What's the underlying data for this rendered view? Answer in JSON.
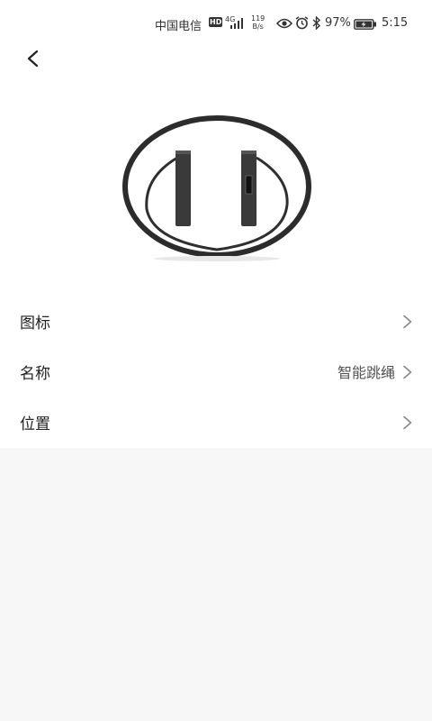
{
  "status_bar": {
    "carrier": "中国电信",
    "hd": "HD",
    "network": "4G",
    "speed_value": "119",
    "speed_unit": "B/s",
    "battery": "97%",
    "time": "5:15"
  },
  "header": {
    "back_icon": "chevron-left-icon"
  },
  "product_image": {
    "icon": "jump-rope-image"
  },
  "settings": [
    {
      "label": "图标",
      "value": "",
      "icon": "chevron-right-icon"
    },
    {
      "label": "名称",
      "value": "智能跳绳",
      "icon": "chevron-right-icon"
    },
    {
      "label": "位置",
      "value": "",
      "icon": "chevron-right-icon"
    }
  ],
  "colors": {
    "surface": "#ffffff",
    "background": "#f7f7f7",
    "text": "#222222",
    "secondary_text": "#555555"
  }
}
